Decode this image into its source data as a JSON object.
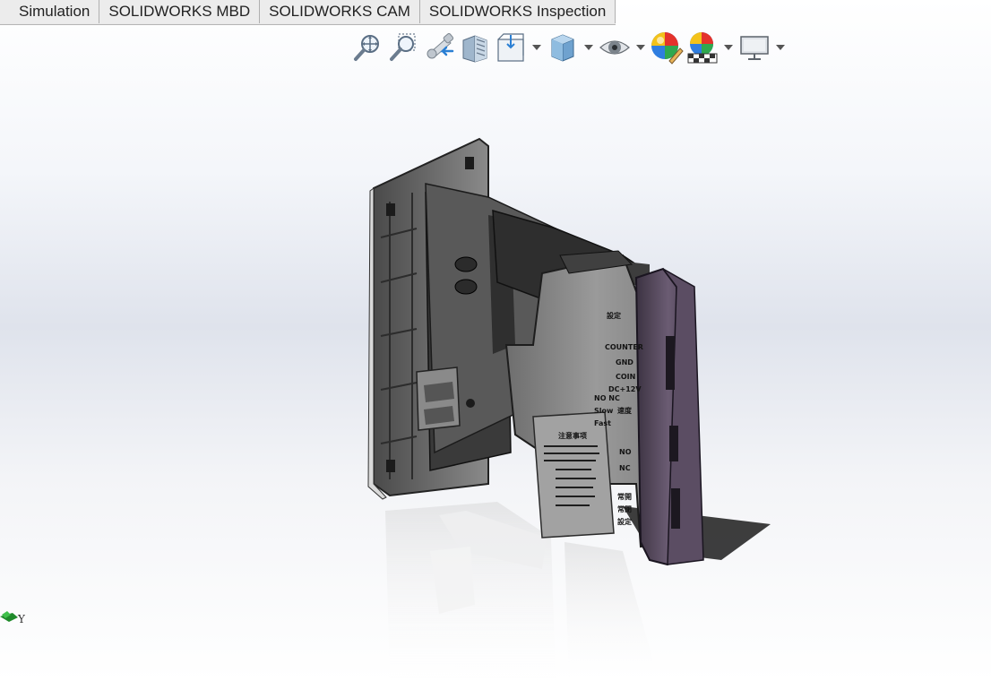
{
  "command_manager": {
    "tabs": [
      {
        "label": "Simulation"
      },
      {
        "label": "SOLIDWORKS MBD"
      },
      {
        "label": "SOLIDWORKS CAM"
      },
      {
        "label": "SOLIDWORKS Inspection"
      }
    ]
  },
  "heads_up_toolbar": {
    "buttons": [
      {
        "icon": "zoom-to-fit-icon",
        "has_dropdown": false
      },
      {
        "icon": "zoom-to-area-icon",
        "has_dropdown": false
      },
      {
        "icon": "previous-view-icon",
        "has_dropdown": false
      },
      {
        "icon": "section-view-icon",
        "has_dropdown": false
      },
      {
        "icon": "view-orientation-icon",
        "has_dropdown": true
      },
      {
        "icon": "display-style-icon",
        "has_dropdown": true
      },
      {
        "icon": "hide-show-items-icon",
        "has_dropdown": true
      },
      {
        "icon": "edit-appearance-icon",
        "has_dropdown": false
      },
      {
        "icon": "apply-scene-icon",
        "has_dropdown": true
      },
      {
        "icon": "view-settings-icon",
        "has_dropdown": true
      }
    ]
  },
  "graphics_area": {
    "model_markings": {
      "top_label": "設定",
      "contact_labels": [
        "COUNTER",
        "GND",
        "COIN",
        "DC+12V",
        "NO",
        "NC"
      ],
      "switch_labels": [
        "NO NC",
        "Slow",
        "Fast",
        "速度"
      ],
      "side_labels": [
        "常開",
        "常閉",
        "設定"
      ],
      "panel_title": "注意事项"
    },
    "triad_axis_label": "Y",
    "colors": {
      "background_top": "#ffffff",
      "background_mid": "#dfe3ec",
      "model_body": "#8a8a8a",
      "model_bezel": "#5b4d63"
    }
  }
}
